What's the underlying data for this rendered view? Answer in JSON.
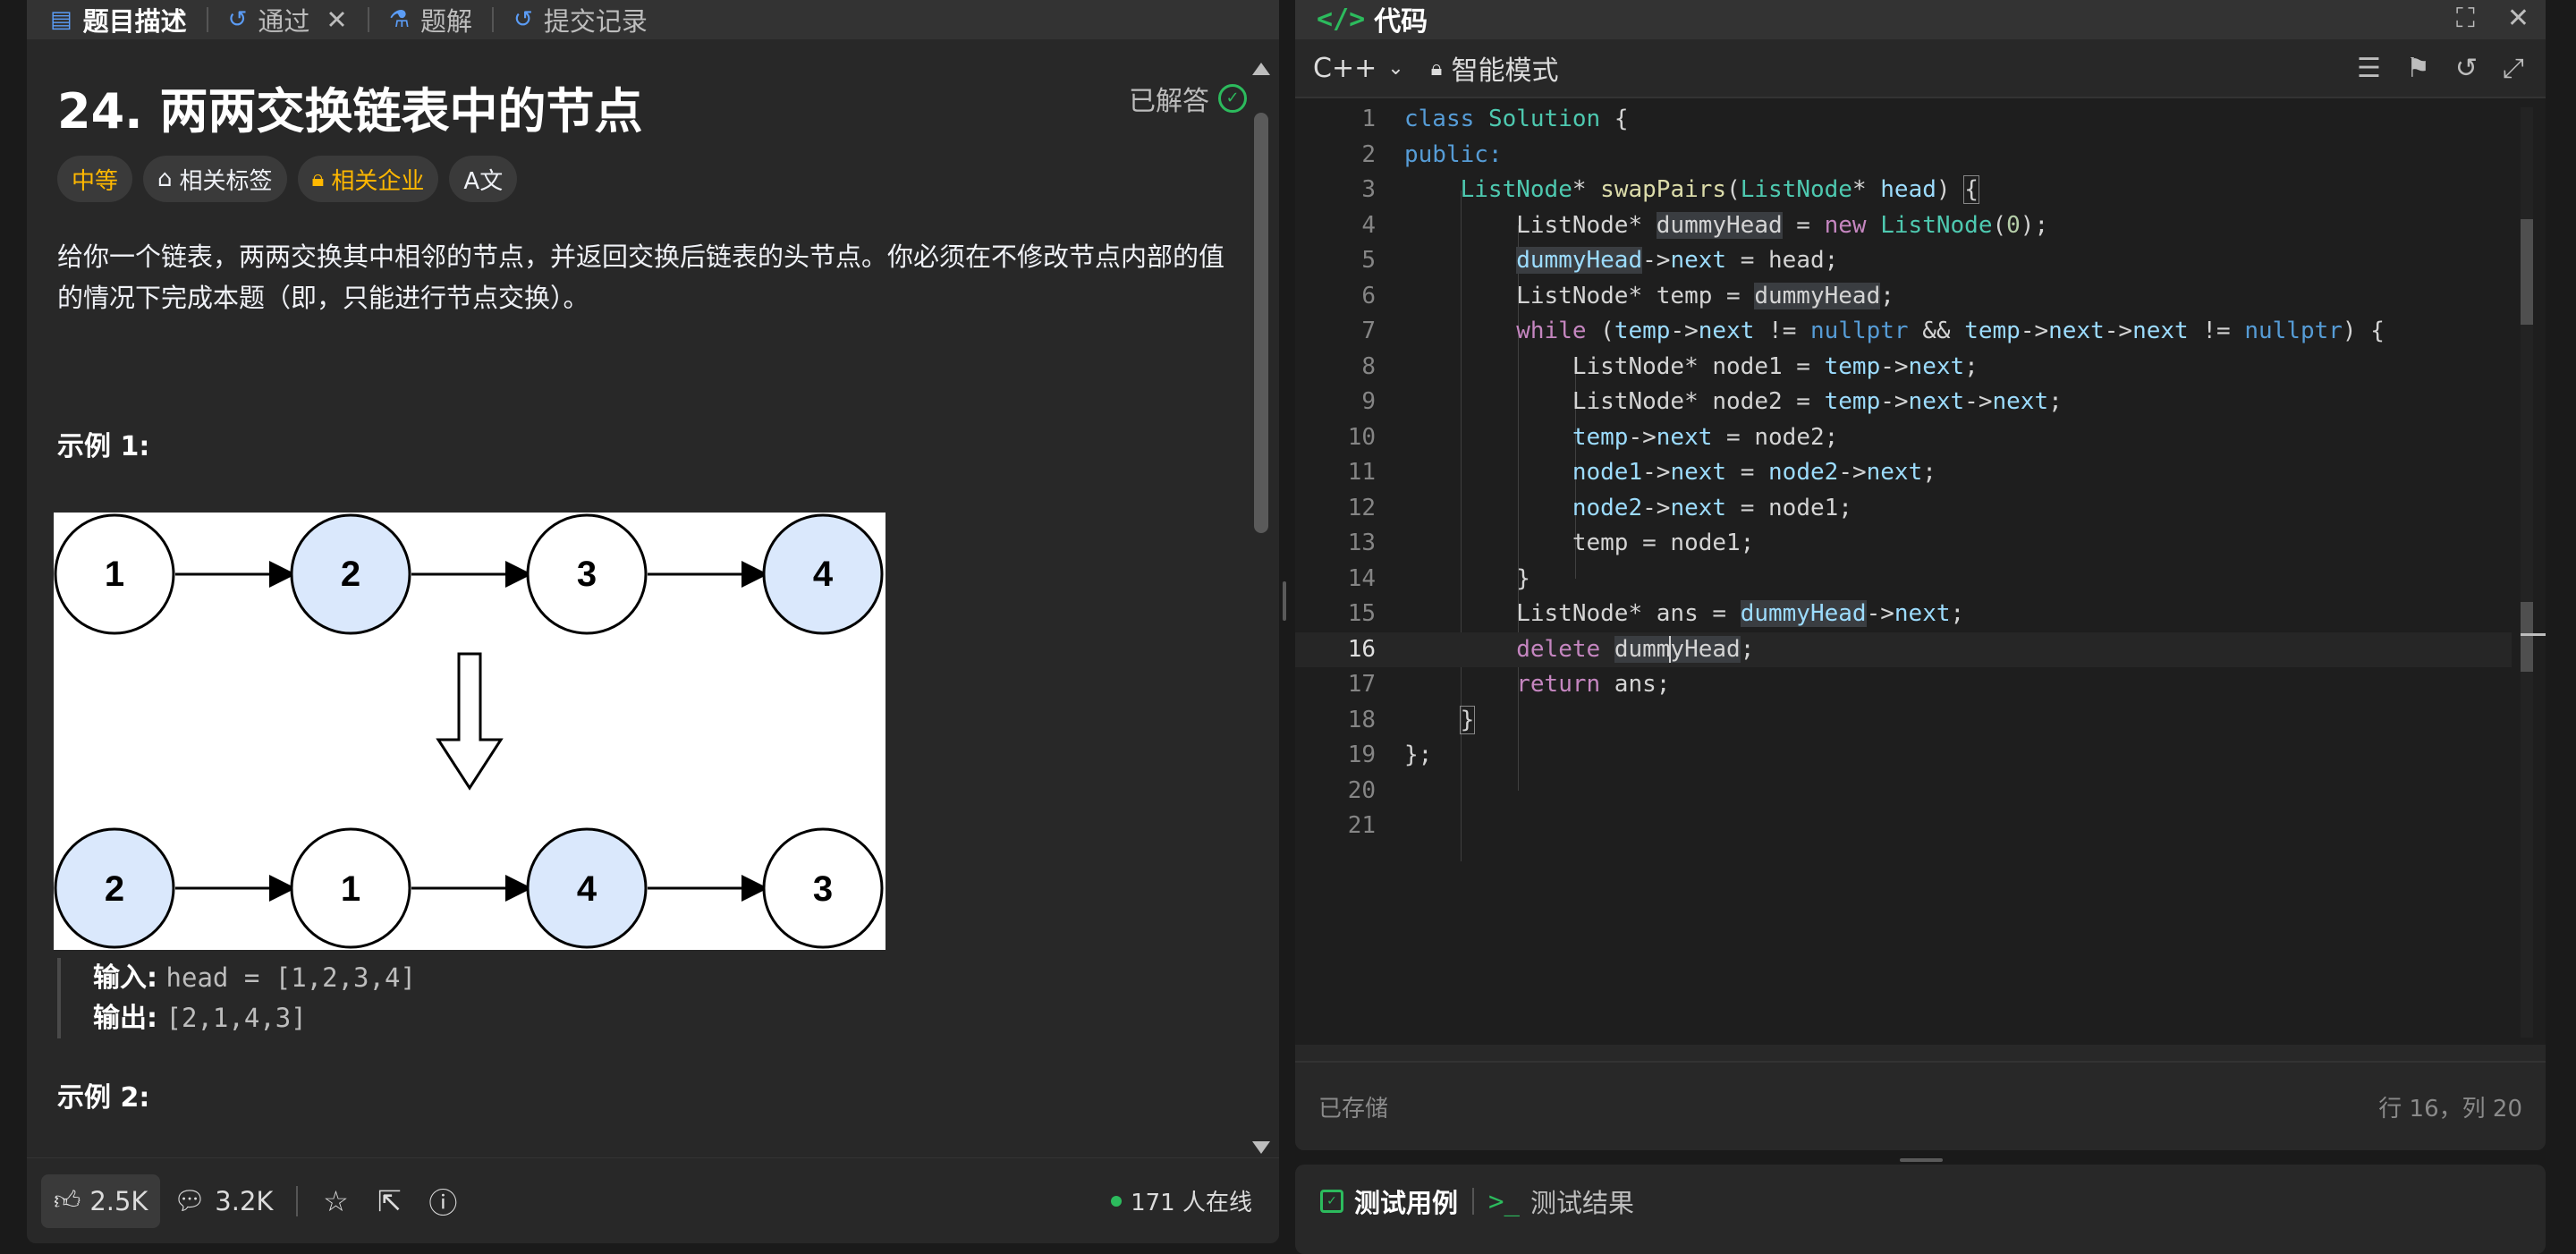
{
  "left_tabs": [
    {
      "label": "题目描述",
      "icon": "description-icon"
    },
    {
      "label": "通过",
      "icon": "history-icon"
    },
    {
      "label": "题解",
      "icon": "flask-icon"
    },
    {
      "label": "提交记录",
      "icon": "history-icon"
    }
  ],
  "problem": {
    "title": "24. 两两交换链表中的节点",
    "status": "已解答",
    "tags": {
      "difficulty": "中等",
      "related_tags": "相关标签",
      "related_companies": "相关企业",
      "translate": "A文"
    },
    "statement": "给你一个链表，两两交换其中相邻的节点，并返回交换后链表的头节点。你必须在不修改节点内部的值的情况下完成本题（即，只能进行节点交换）。",
    "example1_title": "示例 1:",
    "diagram_top": [
      "1",
      "2",
      "3",
      "4"
    ],
    "diagram_bottom": [
      "2",
      "1",
      "4",
      "3"
    ],
    "input_label": "输入:",
    "input_value": "head = [1,2,3,4]",
    "output_label": "输出:",
    "output_value": "[2,1,4,3]",
    "example2_title": "示例 2:"
  },
  "footer": {
    "likes": "2.5K",
    "comments": "3.2K",
    "online": "171 人在线"
  },
  "code_panel": {
    "title": "代码",
    "language": "C++",
    "mode": "智能模式",
    "status_saved": "已存储",
    "cursor_pos": "行 16，列 20"
  },
  "code_lines": [
    "class Solution {",
    "public:",
    "    ListNode* swapPairs(ListNode* head) {",
    "        ListNode* dummyHead = new ListNode(0);",
    "        dummyHead->next = head;",
    "        ListNode* temp = dummyHead;",
    "        while (temp->next != nullptr && temp->next->next != nullptr) {",
    "            ListNode* node1 = temp->next;",
    "            ListNode* node2 = temp->next->next;",
    "            temp->next = node2;",
    "            node1->next = node2->next;",
    "            node2->next = node1;",
    "            temp = node1;",
    "        }",
    "        ListNode* ans = dummyHead->next;",
    "        delete dummyHead;",
    "        return ans;",
    "    }",
    "};",
    "",
    ""
  ],
  "test_panel": {
    "tab_cases": "测试用例",
    "tab_results": "测试结果"
  },
  "colors": {
    "accent_green": "#2cbb5d",
    "medium_yellow": "#ffb800",
    "node_highlight": "#dae8fc"
  }
}
